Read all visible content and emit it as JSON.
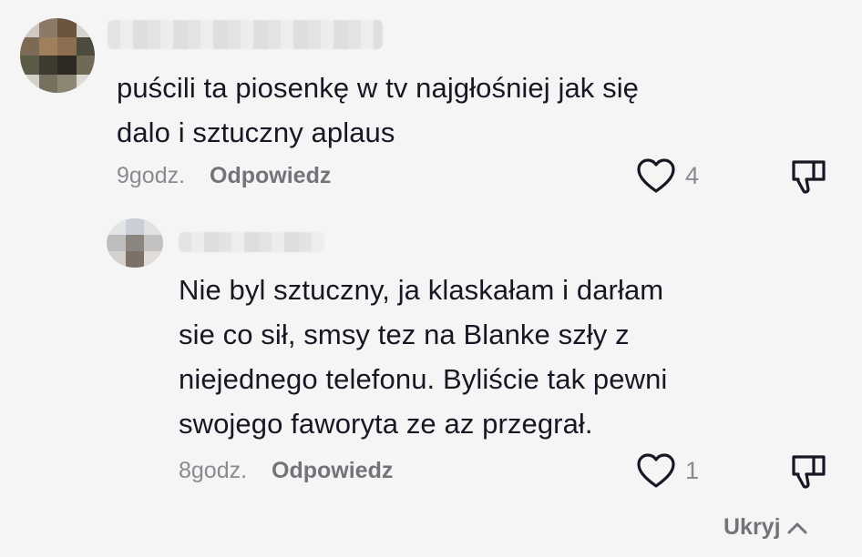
{
  "comments": {
    "main": {
      "text": "puścili ta piosenkę w tv najgłośniej jak się\ndalo i sztuczny aplaus",
      "time": "9godz.",
      "reply_label": "Odpowiedz",
      "likes": "4"
    },
    "reply": {
      "text": "Nie byl sztuczny, ja klaskałam i darłam\nsie co sił, smsy tez na Blanke szły z\nniejednego telefonu. Byliście tak pewni\nswojego faworyta ze az przegrał.",
      "time": "8godz.",
      "reply_label": "Odpowiedz",
      "likes": "1"
    }
  },
  "hide_label": "Ukryj",
  "icons": {
    "like": "heart-outline-icon",
    "dislike": "thumbs-down-icon",
    "hide": "chevron-up-icon"
  },
  "colors": {
    "background": "#f5f5f5",
    "text": "#161823",
    "muted": "#8a8b91"
  }
}
